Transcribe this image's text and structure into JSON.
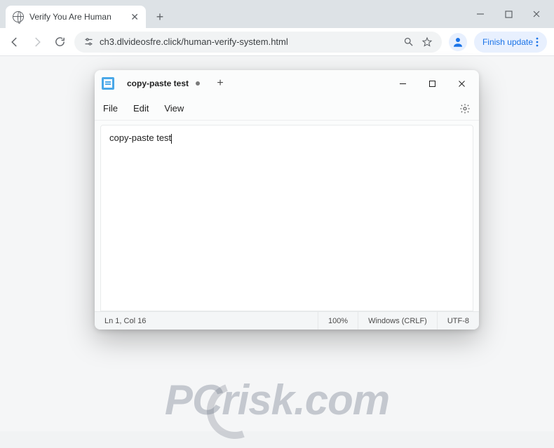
{
  "chrome": {
    "tab_title": "Verify You Are Human",
    "url": "ch3.dlvideosfre.click/human-verify-system.html",
    "finish_update_label": "Finish update"
  },
  "notepad": {
    "tab_title": "copy-paste test",
    "menu": {
      "file": "File",
      "edit": "Edit",
      "view": "View"
    },
    "content": "copy-paste test",
    "status": {
      "pos": "Ln 1, Col 16",
      "zoom": "100%",
      "eol": "Windows (CRLF)",
      "encoding": "UTF-8"
    }
  },
  "watermark": "PCrisk.com"
}
